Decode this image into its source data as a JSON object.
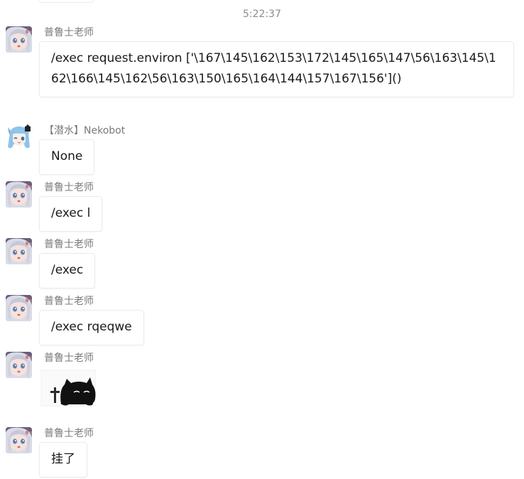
{
  "timestamp": "5:22:37",
  "messages": [
    {
      "sender": "普鲁士老师",
      "avatar_icon": "anime-girl-silver-hair-avatar",
      "type": "text",
      "text": "/exec request.environ ['\\167\\145\\162\\153\\172\\145\\165\\147\\56\\163\\145\\162\\166\\145\\162\\56\\163\\150\\165\\164\\144\\157\\167\\156']()"
    },
    {
      "sender": "【潜水】Nekobot",
      "avatar_icon": "anime-girl-blue-hair-cat-ears-avatar",
      "type": "text",
      "text": "None"
    },
    {
      "sender": "普鲁士老师",
      "avatar_icon": "anime-girl-silver-hair-avatar",
      "type": "text",
      "text": "/exec l"
    },
    {
      "sender": "普鲁士老师",
      "avatar_icon": "anime-girl-silver-hair-avatar",
      "type": "text",
      "text": "/exec"
    },
    {
      "sender": "普鲁士老师",
      "avatar_icon": "anime-girl-silver-hair-avatar",
      "type": "text",
      "text": "/exec rqeqwe"
    },
    {
      "sender": "普鲁士老师",
      "avatar_icon": "anime-girl-silver-hair-avatar",
      "type": "sticker",
      "sticker_icon": "black-cat-with-grave-cross-sticker"
    },
    {
      "sender": "普鲁士老师",
      "avatar_icon": "anime-girl-silver-hair-avatar",
      "type": "text",
      "text": "挂了"
    }
  ]
}
